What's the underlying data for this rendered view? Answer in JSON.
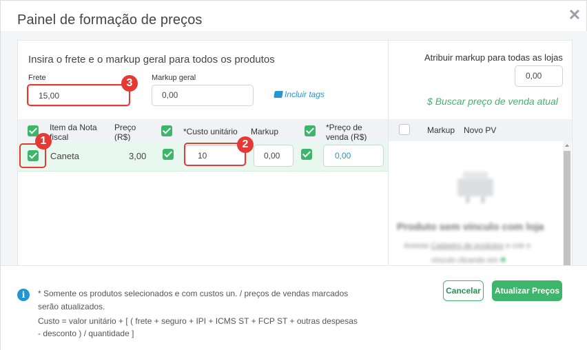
{
  "modal": {
    "title": "Painel de formação de preços",
    "close_icon": "close-icon"
  },
  "left": {
    "heading": "Insira o frete e o markup geral para todos os produtos",
    "frete_label": "Frete",
    "frete_value": "15,00",
    "markup_label": "Markup geral",
    "markup_value": "0,00",
    "tags_link": "Incluir tags",
    "tags_icon": "tag-icon"
  },
  "table": {
    "headers": {
      "item_line1": "Item da Nota",
      "item_line2": "fiscal",
      "preco_line1": "Preço",
      "preco_line2": "(R$)",
      "custo": "*Custo unitário",
      "markup": "Markup",
      "pv_line1": "*Preço de",
      "pv_line2": "venda (R$)"
    },
    "rows": [
      {
        "selected": true,
        "item": "Caneta",
        "preco": "3,00",
        "custo_checked": true,
        "custo": "10",
        "markup": "0,00",
        "pv_checked": true,
        "preco_venda": "0,00"
      }
    ]
  },
  "right": {
    "markup_all_label": "Atribuir markup para todas as lojas",
    "markup_all_value": "0,00",
    "search_link": "Buscar preço de venda atual",
    "search_icon": "dollar-icon",
    "col_markup": "Markup",
    "col_novo_pv": "Novo PV",
    "empty_title": "Produto sem vínculo com loja",
    "empty_line1_a": "Acesse",
    "empty_line1_link": "Cadastro de produtos",
    "empty_line1_b": "e crie o",
    "empty_line2": "vínculo clicando em"
  },
  "annotations": [
    "1",
    "2",
    "3"
  ],
  "footer": {
    "note_line1": "* Somente os produtos selecionados e com custos un. / preços de vendas marcados",
    "note_line2": "serão atualizados.",
    "note_line3": "Custo = valor unitário + [ ( frete + seguro + IPI + ICMS ST + FCP ST + outras despesas",
    "note_line4": "- desconto ) / quantidade ]",
    "cancel_label": "Cancelar",
    "update_label": "Atualizar Preços",
    "info_icon": "info-icon"
  },
  "colors": {
    "accent_green": "#3db56a",
    "link_blue": "#2196d3",
    "annotation_red": "#e53935",
    "selected_row": "#e8f8ee"
  }
}
